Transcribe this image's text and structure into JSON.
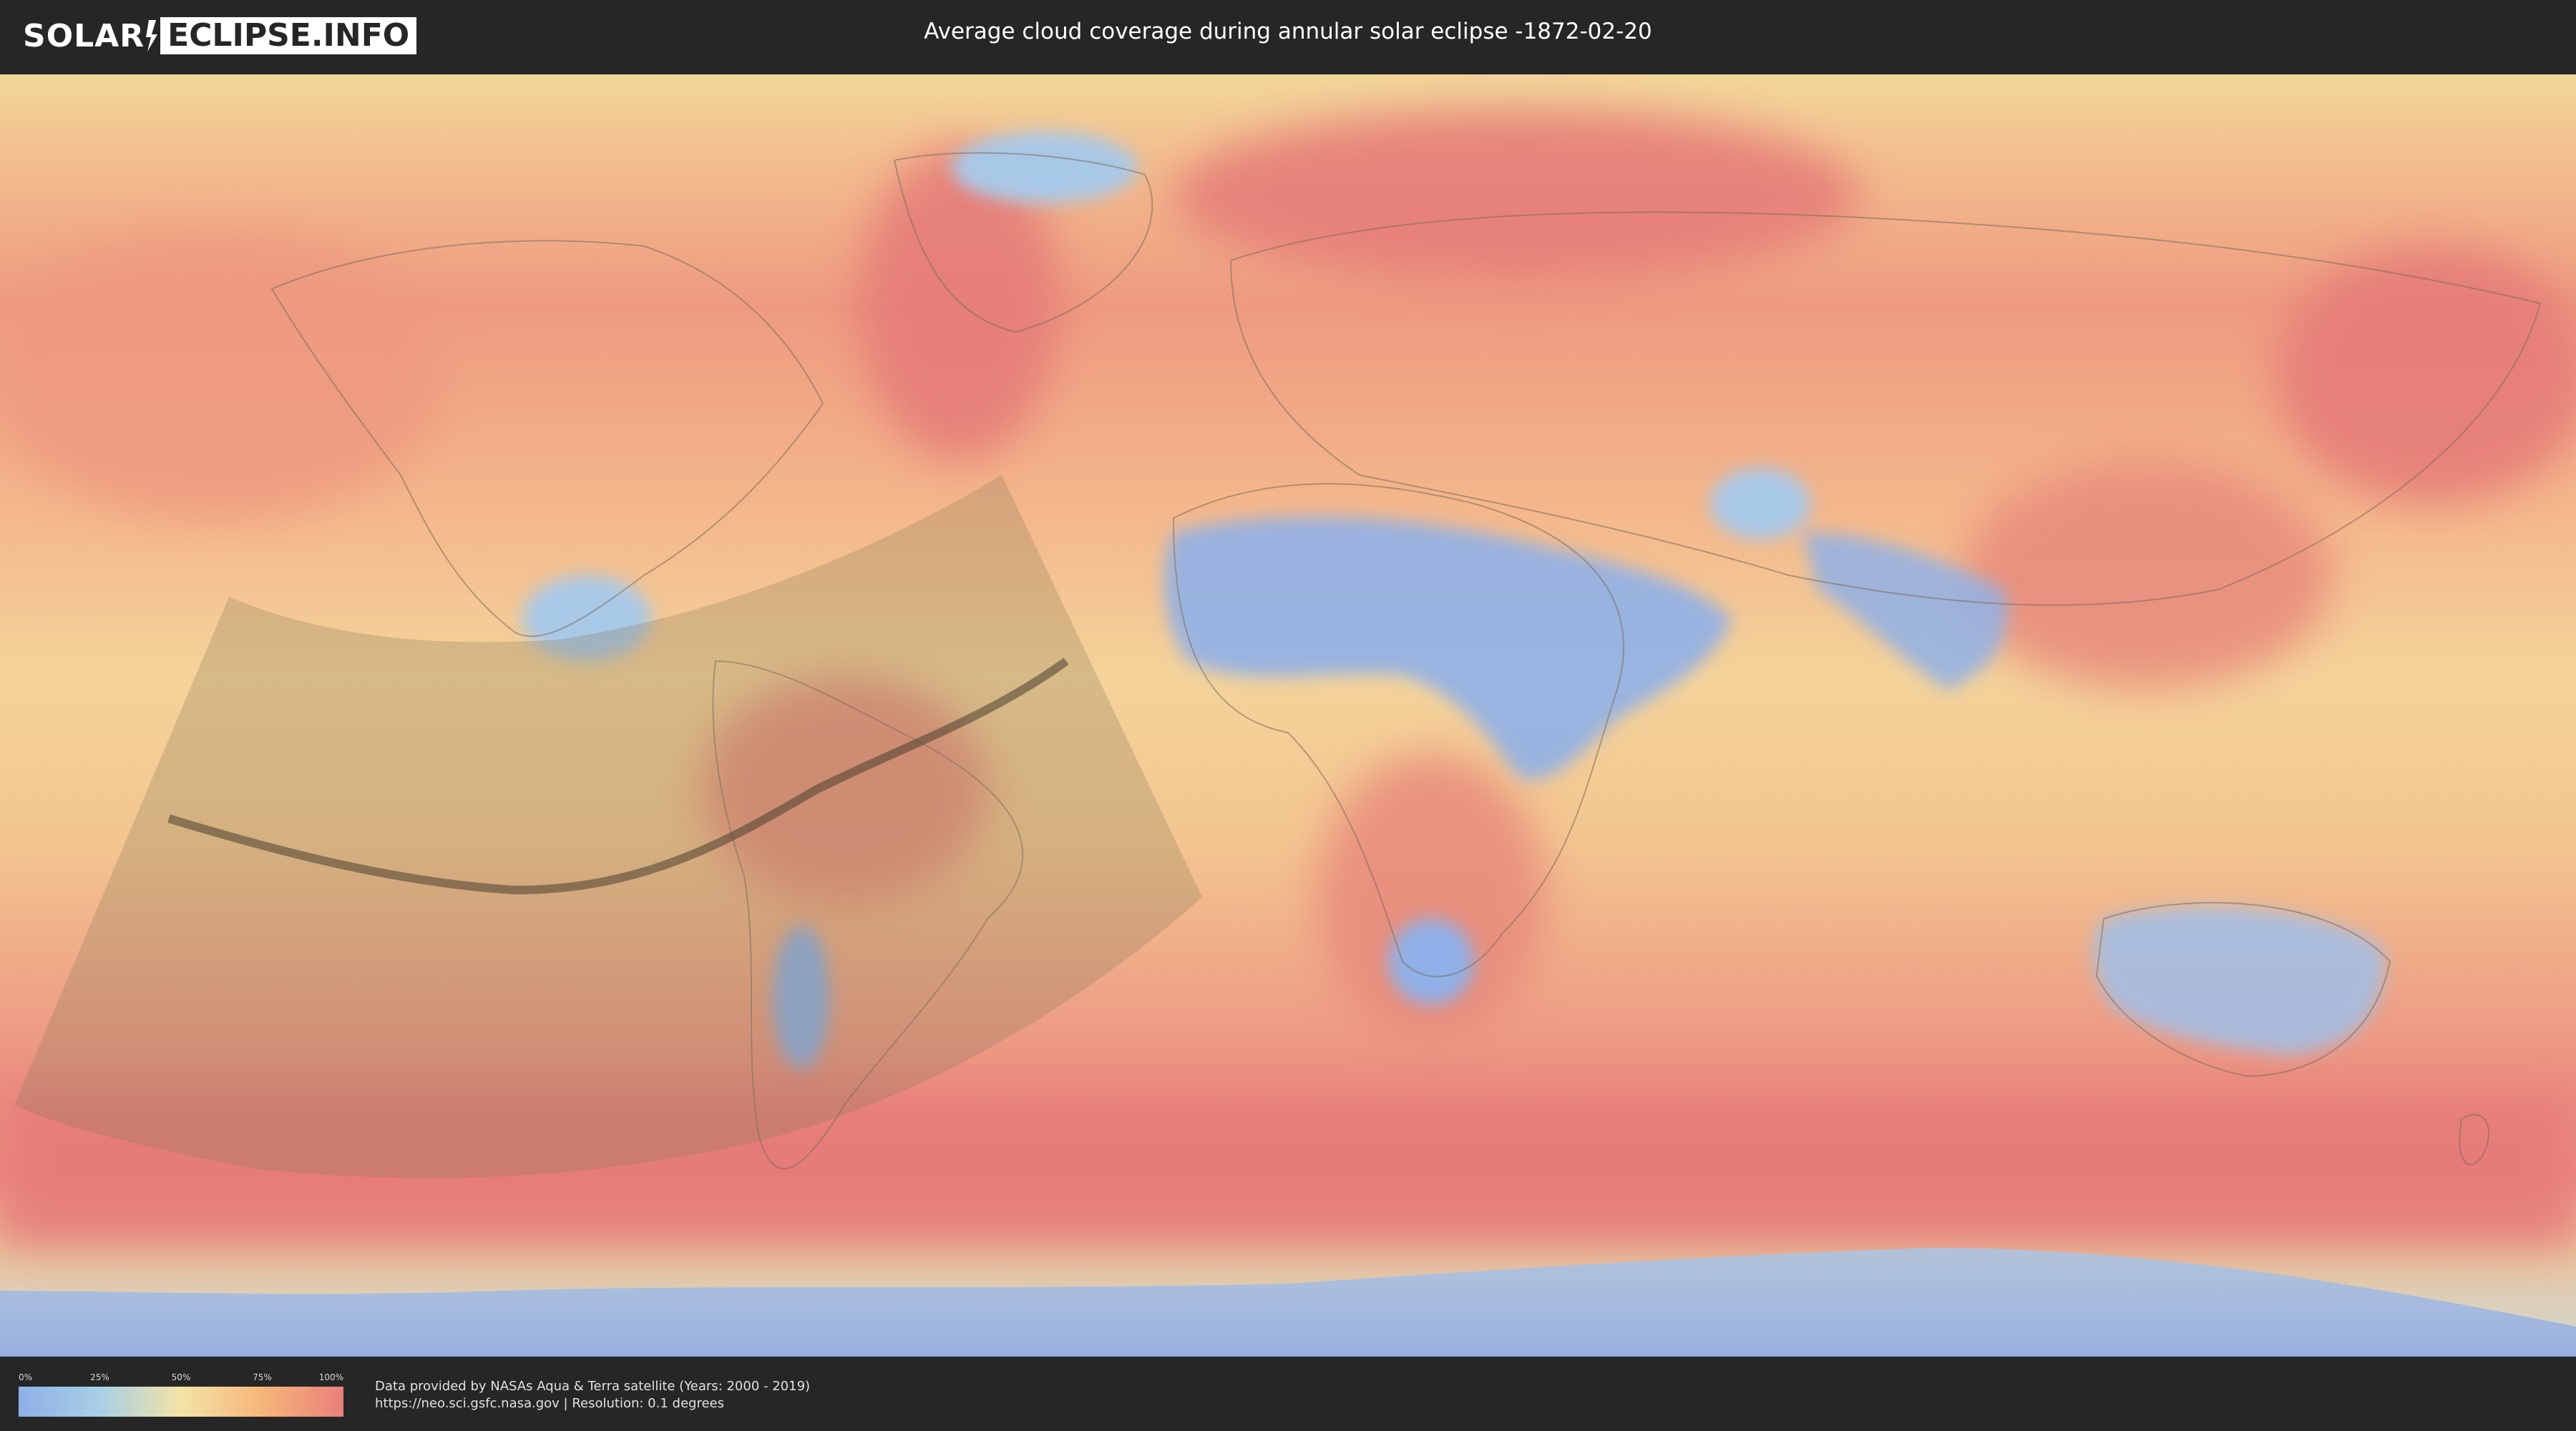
{
  "header": {
    "logo_left": "SOLAR",
    "logo_right": "ECLIPSE.INFO",
    "title": "Average cloud coverage during annular solar eclipse -1872-02-20"
  },
  "legend": {
    "ticks": [
      "0%",
      "25%",
      "50%",
      "75%",
      "100%"
    ],
    "scale_colors": [
      "#8fb0e8",
      "#a8cfe6",
      "#f3e3a6",
      "#f6b67a",
      "#ea7f7a"
    ]
  },
  "footer": {
    "credit_line1": "Data provided by NASAs Aqua & Terra satellite (Years: 2000 - 2019)",
    "credit_line2": "https://neo.sci.gsfc.nasa.gov | Resolution: 0.1 degrees"
  },
  "map": {
    "projection": "equirectangular",
    "layer": "cloud coverage",
    "eclipse_shadow_color": "#8a7a55",
    "central_line_color": "#4a3f30"
  }
}
